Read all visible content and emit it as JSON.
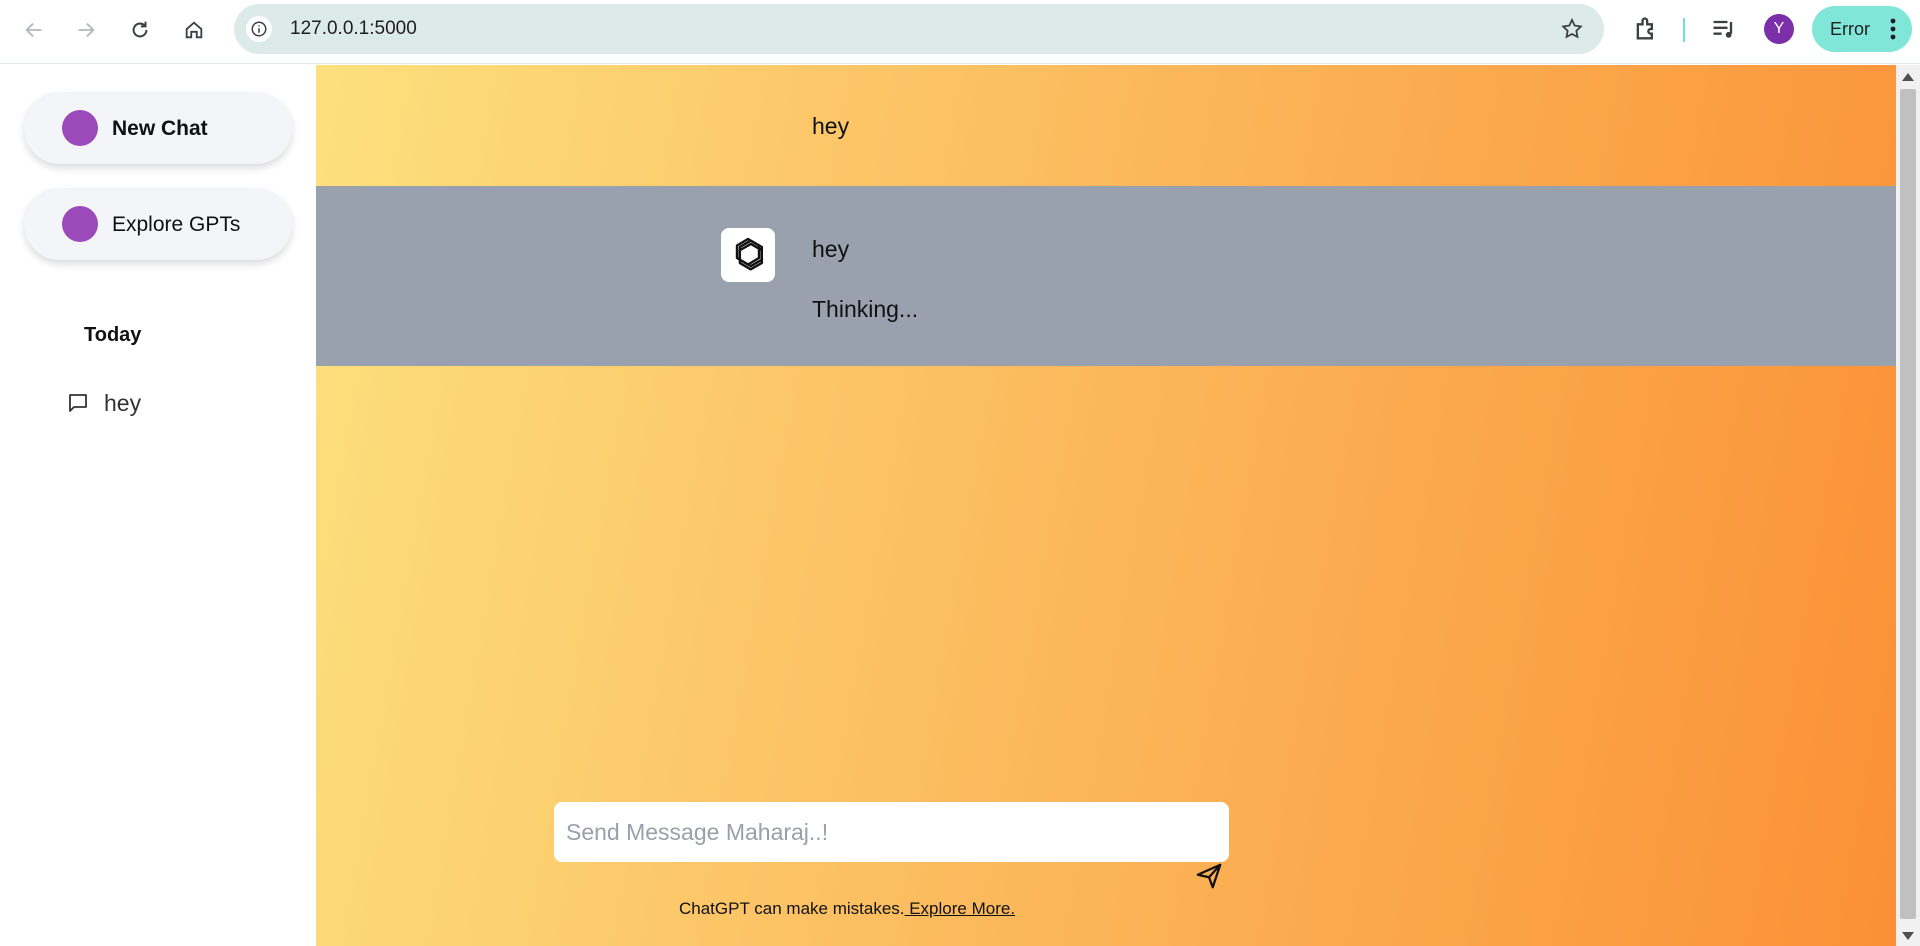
{
  "browser": {
    "url": "127.0.0.1:5000",
    "profile_initial": "Y",
    "error_label": "Error"
  },
  "sidebar": {
    "new_chat_label": "New Chat",
    "explore_label": "Explore GPTs",
    "section_label": "Today",
    "history": [
      {
        "label": "hey"
      }
    ]
  },
  "chat": {
    "messages": [
      {
        "role": "user",
        "text": "hey"
      },
      {
        "role": "assistant",
        "text": "hey",
        "status": "Thinking..."
      }
    ]
  },
  "composer": {
    "placeholder": "Send Message Maharaj..!",
    "value": ""
  },
  "footer": {
    "text": "ChatGPT can make mistakes.",
    "link_text": " Explore More."
  },
  "colors": {
    "gradient_start": "#fde07e",
    "gradient_end": "#fb9036",
    "assistant_bg": "#9aa1ae",
    "accent_dot": "#9b4ab9"
  }
}
